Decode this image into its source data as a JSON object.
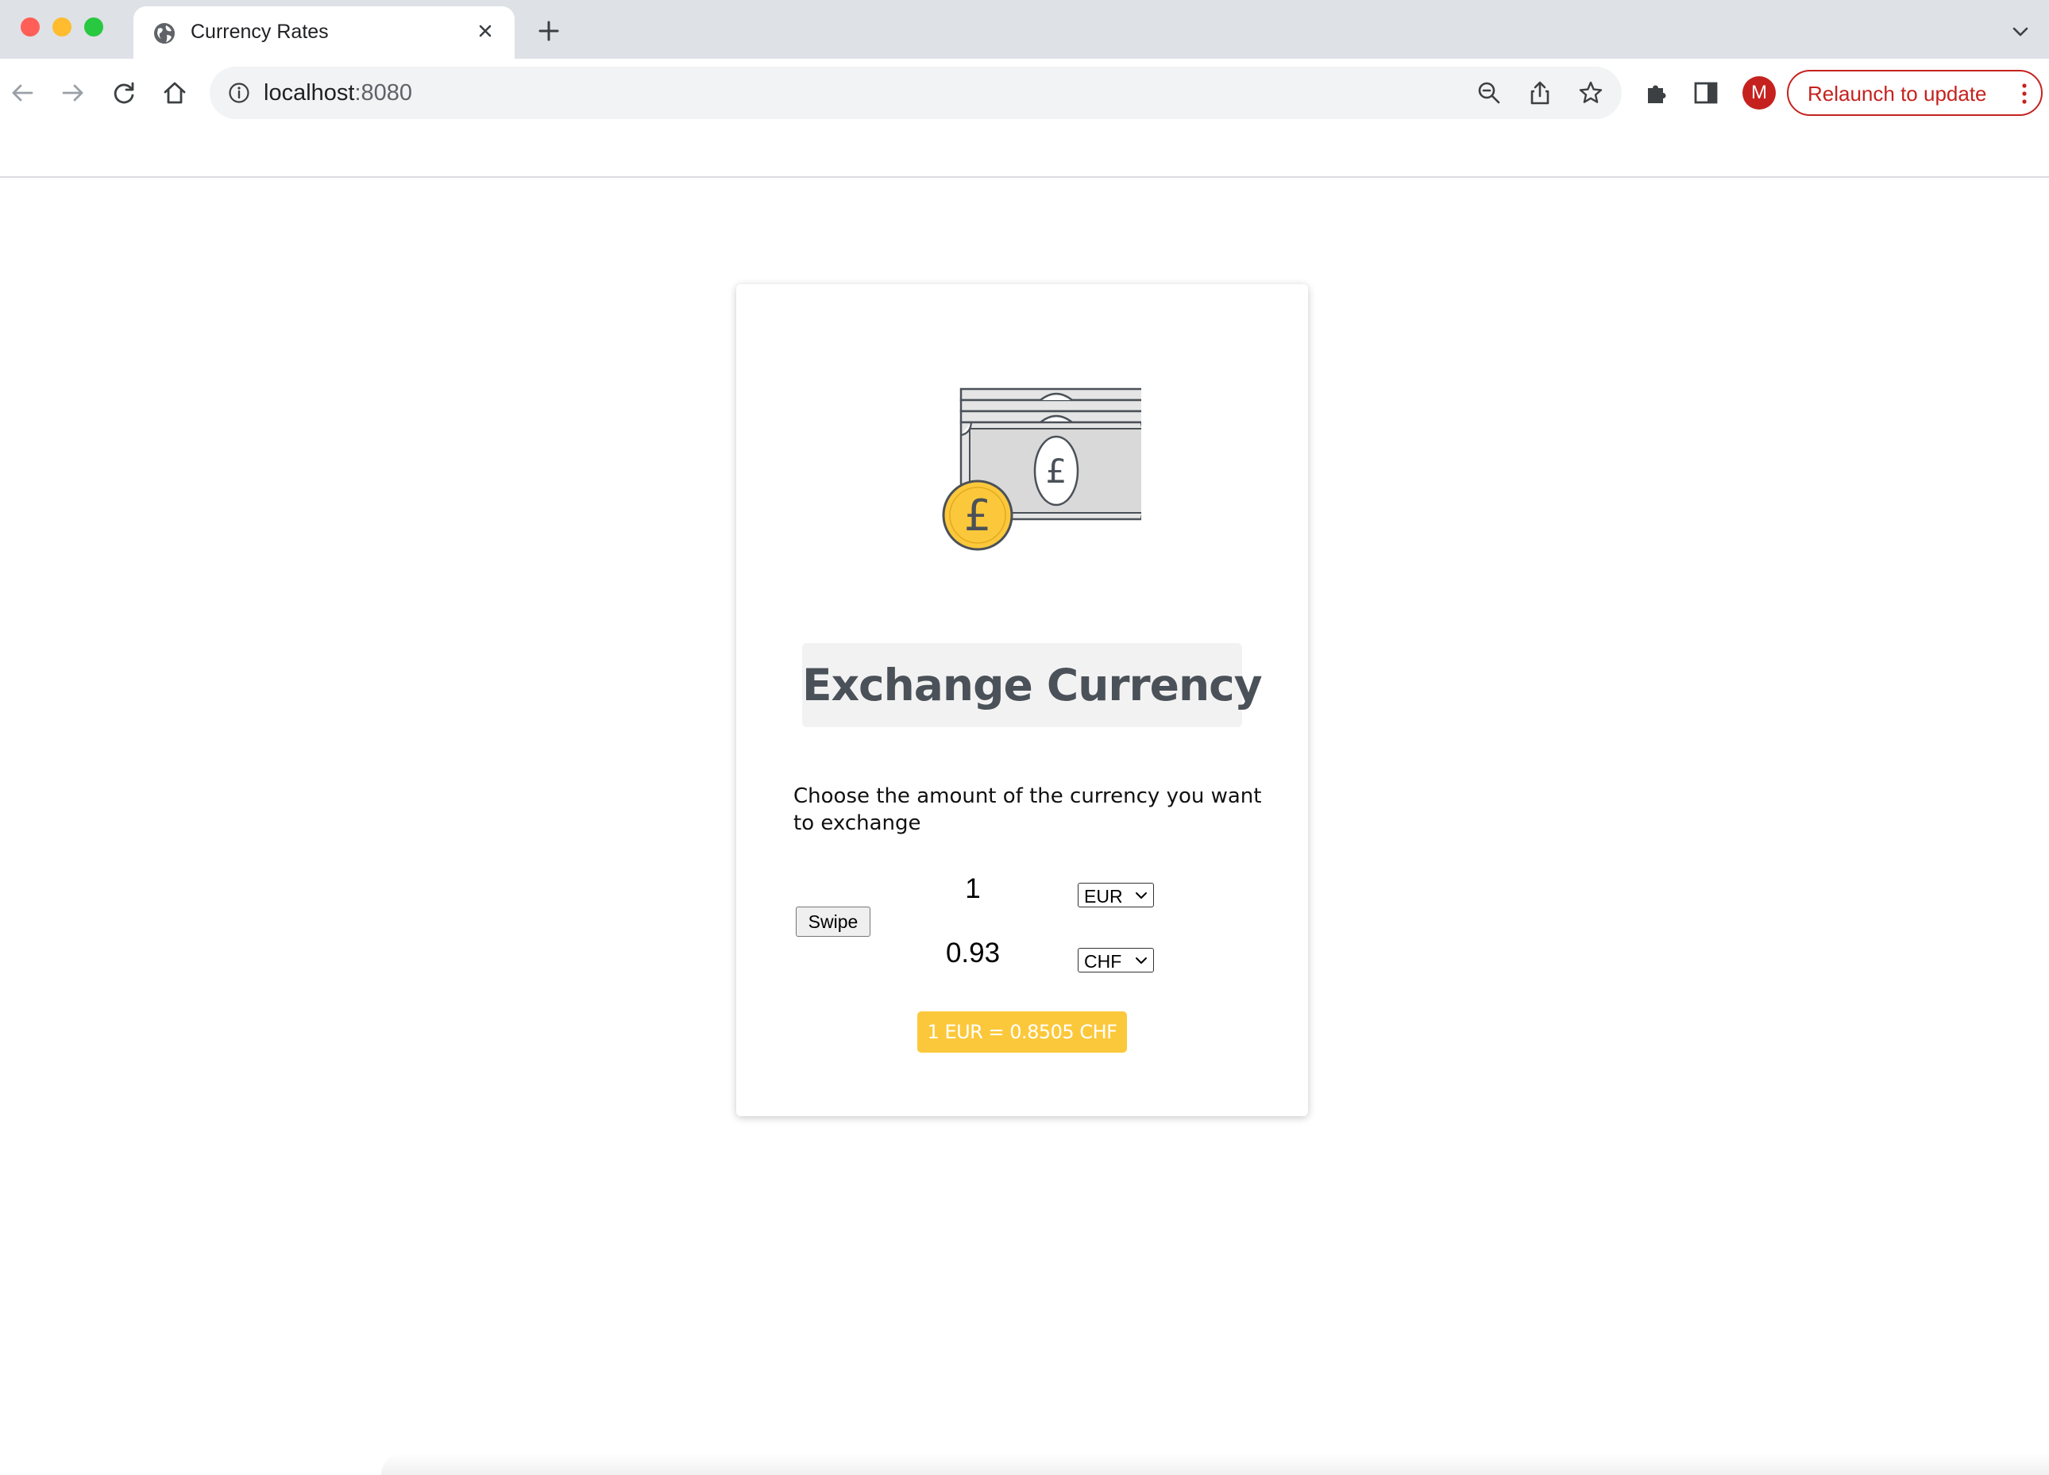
{
  "browser": {
    "tab": {
      "title": "Currency Rates",
      "favicon": "globe-icon"
    },
    "omnibox": {
      "host": "localhost",
      "port": ":8080"
    },
    "profile_initial": "M",
    "relaunch_label": "Relaunch to update",
    "colors": {
      "tabbar": "#dee1e6",
      "relaunch": "#c5221f"
    }
  },
  "page": {
    "illustration": "pound-banknotes-and-coin-illustration",
    "heading": "Exchange Currency",
    "instruction": "Choose the amount of the currency you want to exchange",
    "swipe_label": "Swipe",
    "from": {
      "amount": "1",
      "currency": "EUR"
    },
    "to": {
      "amount": "0.93",
      "currency": "CHF"
    },
    "rate": "1 EUR = 0.8505 CHF",
    "colors": {
      "heading": "#4b5158",
      "heading_bg": "#f2f2f2",
      "rate_bg": "#fcc83b",
      "coin": "#fcc83b"
    }
  }
}
